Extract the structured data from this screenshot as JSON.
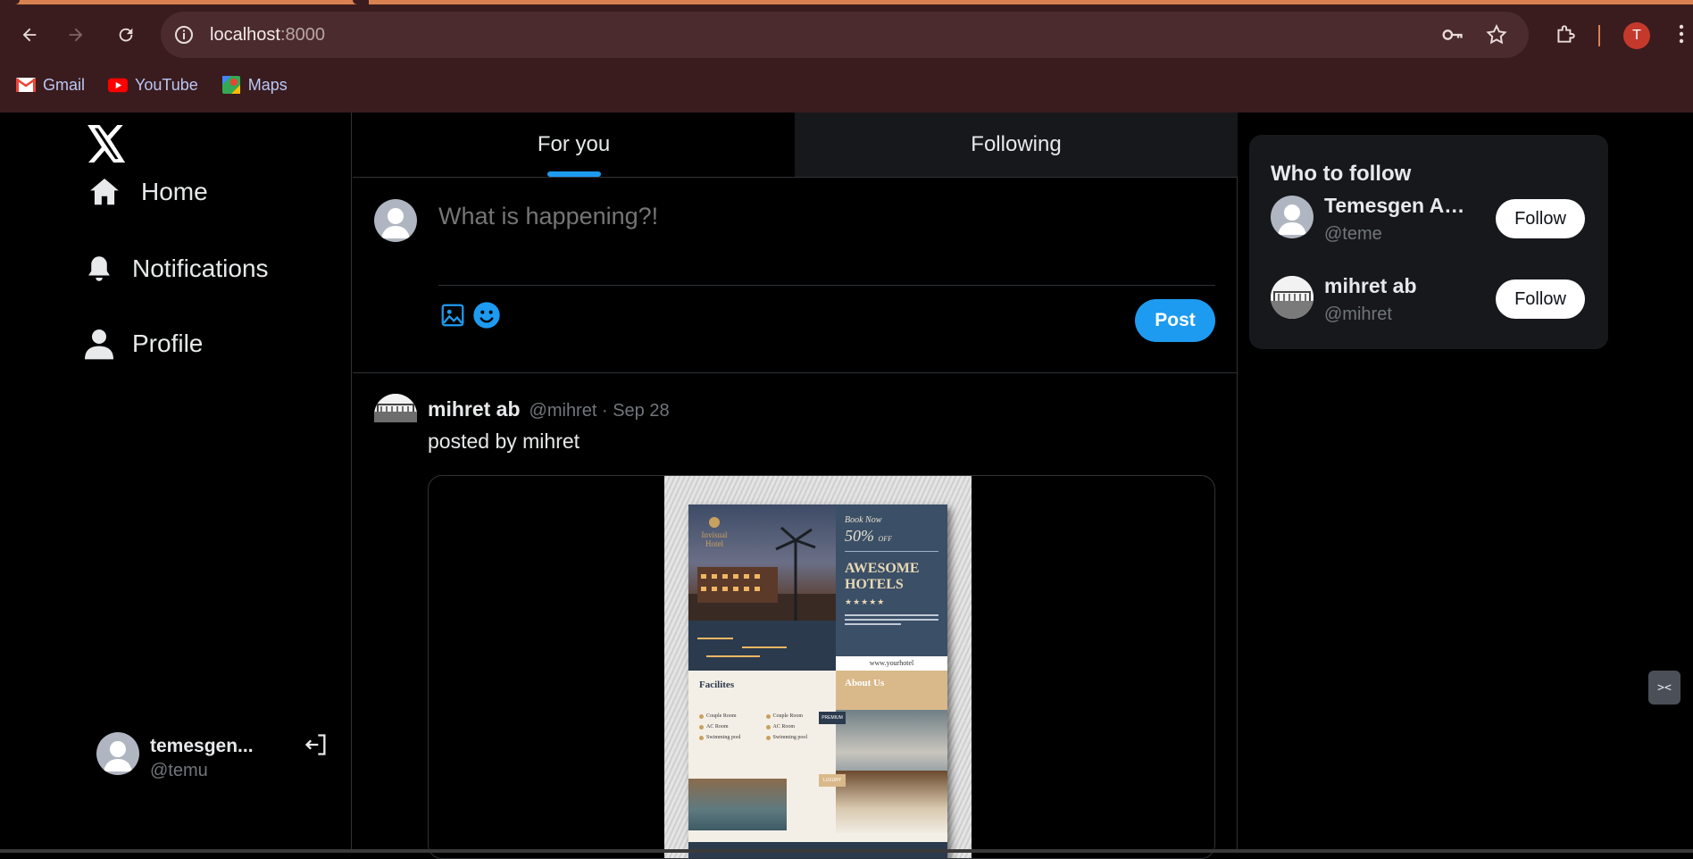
{
  "browser": {
    "url_host": "localhost",
    "url_port": ":8000",
    "profile_initial": "T",
    "bookmarks": [
      {
        "label": "Gmail",
        "icon": "gmail-icon"
      },
      {
        "label": "YouTube",
        "icon": "youtube-icon"
      },
      {
        "label": "Maps",
        "icon": "maps-icon"
      }
    ]
  },
  "nav": {
    "items": [
      {
        "label": "Home",
        "icon": "home-icon"
      },
      {
        "label": "Notifications",
        "icon": "bell-icon"
      },
      {
        "label": "Profile",
        "icon": "user-icon"
      }
    ],
    "account": {
      "name": "temesgen...",
      "handle": "@temu"
    }
  },
  "tabs": {
    "for_you": "For you",
    "following": "Following"
  },
  "composer": {
    "placeholder": "What is happening?!",
    "post_label": "Post"
  },
  "feed": [
    {
      "name": "mihret ab",
      "handle": "@mihret",
      "separator": "·",
      "date": "Sep 28",
      "text": "posted by mihret",
      "media": {
        "logo_text": "Invisual Hotel",
        "book_now": "Book Now",
        "discount": "50%",
        "discount_suffix": "OFF",
        "headline": "AWESOME HOTELS",
        "stars": "★★★★★",
        "url": "www.yourhotel",
        "facilities_title": "Facilites",
        "facilities": [
          "Couple Room",
          "Couple Room",
          "AC Room",
          "AC Room",
          "Swimming pool",
          "Swimming pool"
        ],
        "about_title": "About Us",
        "premium": "PREMIUM",
        "luxury": "LUXURY"
      }
    }
  ],
  "who_to_follow": {
    "title": "Who to follow",
    "follow_label": "Follow",
    "users": [
      {
        "name": "Temesgen Ab...",
        "handle": "@teme"
      },
      {
        "name": "mihret ab",
        "handle": "@mihret"
      }
    ]
  },
  "colors": {
    "accent": "#1d9bf0",
    "chrome": "#3a1c1e",
    "chrome_accent": "#d9824f"
  }
}
